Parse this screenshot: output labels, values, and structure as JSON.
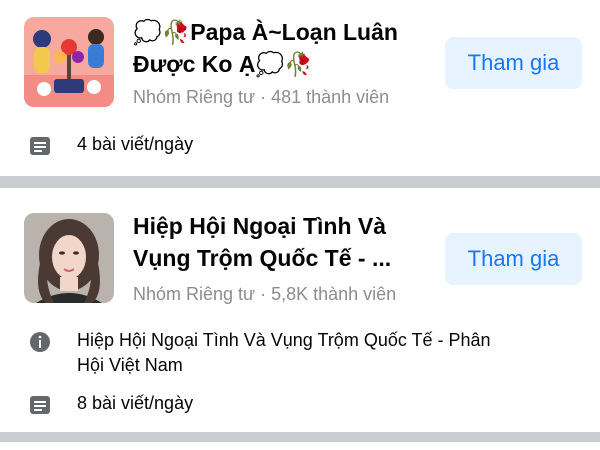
{
  "groups": [
    {
      "title": "💭🥀Papa À~Loạn Luân Được Ko Ạ💭🥀",
      "title_line1": "💭🥀Papa À~Loạn Luân",
      "title_line2": "Được Ko Ạ💭🥀",
      "privacy": "Nhóm Riêng tư",
      "members": "481 thành viên",
      "meta": "Nhóm Riêng tư · 481 thành viên",
      "join_label": "Tham gia",
      "posts_per_day": "4 bài viết/ngày",
      "thumbnail_icon": "group-illustration"
    },
    {
      "title_line1": "Hiệp Hội Ngoại Tình Và",
      "title_line2": "Vụng Trộm Quốc Tế - ...",
      "privacy": "Nhóm Riêng tư",
      "members": "5,8K thành viên",
      "meta": "Nhóm Riêng tư · 5,8K thành viên",
      "join_label": "Tham gia",
      "description_line1": "Hiệp Hội Ngoại Tình Và Vụng Trộm Quốc Tế - Phân",
      "description_line2": "Hội Việt Nam",
      "posts_per_day": "8 bài viết/ngày",
      "thumbnail_icon": "woman-portrait"
    }
  ],
  "colors": {
    "join_bg": "#e7f3ff",
    "join_text": "#1877f2",
    "meta_text": "#8a8d91",
    "separator": "#c9ccd1"
  }
}
